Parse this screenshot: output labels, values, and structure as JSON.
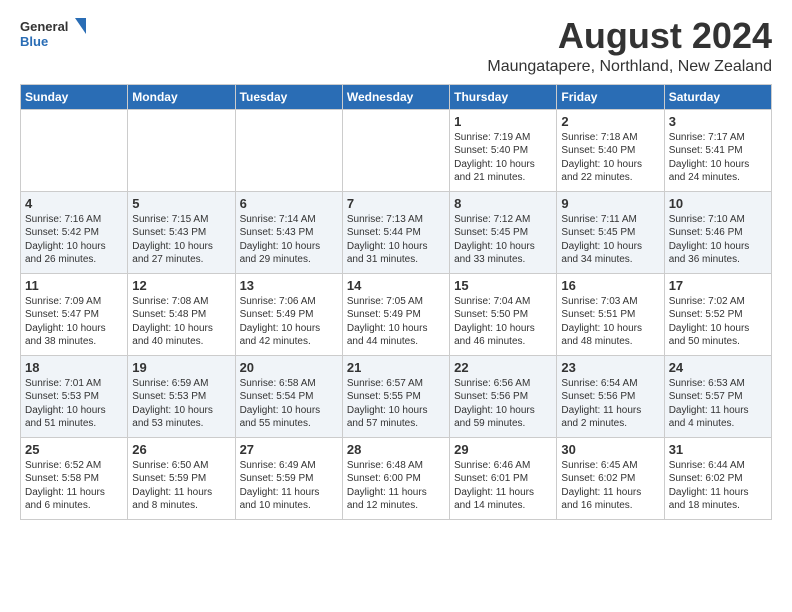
{
  "header": {
    "logo_general": "General",
    "logo_blue": "Blue",
    "title": "August 2024",
    "subtitle": "Maungatapere, Northland, New Zealand"
  },
  "columns": [
    "Sunday",
    "Monday",
    "Tuesday",
    "Wednesday",
    "Thursday",
    "Friday",
    "Saturday"
  ],
  "weeks": [
    [
      {
        "day": "",
        "info": ""
      },
      {
        "day": "",
        "info": ""
      },
      {
        "day": "",
        "info": ""
      },
      {
        "day": "",
        "info": ""
      },
      {
        "day": "1",
        "info": "Sunrise: 7:19 AM\nSunset: 5:40 PM\nDaylight: 10 hours\nand 21 minutes."
      },
      {
        "day": "2",
        "info": "Sunrise: 7:18 AM\nSunset: 5:40 PM\nDaylight: 10 hours\nand 22 minutes."
      },
      {
        "day": "3",
        "info": "Sunrise: 7:17 AM\nSunset: 5:41 PM\nDaylight: 10 hours\nand 24 minutes."
      }
    ],
    [
      {
        "day": "4",
        "info": "Sunrise: 7:16 AM\nSunset: 5:42 PM\nDaylight: 10 hours\nand 26 minutes."
      },
      {
        "day": "5",
        "info": "Sunrise: 7:15 AM\nSunset: 5:43 PM\nDaylight: 10 hours\nand 27 minutes."
      },
      {
        "day": "6",
        "info": "Sunrise: 7:14 AM\nSunset: 5:43 PM\nDaylight: 10 hours\nand 29 minutes."
      },
      {
        "day": "7",
        "info": "Sunrise: 7:13 AM\nSunset: 5:44 PM\nDaylight: 10 hours\nand 31 minutes."
      },
      {
        "day": "8",
        "info": "Sunrise: 7:12 AM\nSunset: 5:45 PM\nDaylight: 10 hours\nand 33 minutes."
      },
      {
        "day": "9",
        "info": "Sunrise: 7:11 AM\nSunset: 5:45 PM\nDaylight: 10 hours\nand 34 minutes."
      },
      {
        "day": "10",
        "info": "Sunrise: 7:10 AM\nSunset: 5:46 PM\nDaylight: 10 hours\nand 36 minutes."
      }
    ],
    [
      {
        "day": "11",
        "info": "Sunrise: 7:09 AM\nSunset: 5:47 PM\nDaylight: 10 hours\nand 38 minutes."
      },
      {
        "day": "12",
        "info": "Sunrise: 7:08 AM\nSunset: 5:48 PM\nDaylight: 10 hours\nand 40 minutes."
      },
      {
        "day": "13",
        "info": "Sunrise: 7:06 AM\nSunset: 5:49 PM\nDaylight: 10 hours\nand 42 minutes."
      },
      {
        "day": "14",
        "info": "Sunrise: 7:05 AM\nSunset: 5:49 PM\nDaylight: 10 hours\nand 44 minutes."
      },
      {
        "day": "15",
        "info": "Sunrise: 7:04 AM\nSunset: 5:50 PM\nDaylight: 10 hours\nand 46 minutes."
      },
      {
        "day": "16",
        "info": "Sunrise: 7:03 AM\nSunset: 5:51 PM\nDaylight: 10 hours\nand 48 minutes."
      },
      {
        "day": "17",
        "info": "Sunrise: 7:02 AM\nSunset: 5:52 PM\nDaylight: 10 hours\nand 50 minutes."
      }
    ],
    [
      {
        "day": "18",
        "info": "Sunrise: 7:01 AM\nSunset: 5:53 PM\nDaylight: 10 hours\nand 51 minutes."
      },
      {
        "day": "19",
        "info": "Sunrise: 6:59 AM\nSunset: 5:53 PM\nDaylight: 10 hours\nand 53 minutes."
      },
      {
        "day": "20",
        "info": "Sunrise: 6:58 AM\nSunset: 5:54 PM\nDaylight: 10 hours\nand 55 minutes."
      },
      {
        "day": "21",
        "info": "Sunrise: 6:57 AM\nSunset: 5:55 PM\nDaylight: 10 hours\nand 57 minutes."
      },
      {
        "day": "22",
        "info": "Sunrise: 6:56 AM\nSunset: 5:56 PM\nDaylight: 10 hours\nand 59 minutes."
      },
      {
        "day": "23",
        "info": "Sunrise: 6:54 AM\nSunset: 5:56 PM\nDaylight: 11 hours\nand 2 minutes."
      },
      {
        "day": "24",
        "info": "Sunrise: 6:53 AM\nSunset: 5:57 PM\nDaylight: 11 hours\nand 4 minutes."
      }
    ],
    [
      {
        "day": "25",
        "info": "Sunrise: 6:52 AM\nSunset: 5:58 PM\nDaylight: 11 hours\nand 6 minutes."
      },
      {
        "day": "26",
        "info": "Sunrise: 6:50 AM\nSunset: 5:59 PM\nDaylight: 11 hours\nand 8 minutes."
      },
      {
        "day": "27",
        "info": "Sunrise: 6:49 AM\nSunset: 5:59 PM\nDaylight: 11 hours\nand 10 minutes."
      },
      {
        "day": "28",
        "info": "Sunrise: 6:48 AM\nSunset: 6:00 PM\nDaylight: 11 hours\nand 12 minutes."
      },
      {
        "day": "29",
        "info": "Sunrise: 6:46 AM\nSunset: 6:01 PM\nDaylight: 11 hours\nand 14 minutes."
      },
      {
        "day": "30",
        "info": "Sunrise: 6:45 AM\nSunset: 6:02 PM\nDaylight: 11 hours\nand 16 minutes."
      },
      {
        "day": "31",
        "info": "Sunrise: 6:44 AM\nSunset: 6:02 PM\nDaylight: 11 hours\nand 18 minutes."
      }
    ]
  ]
}
